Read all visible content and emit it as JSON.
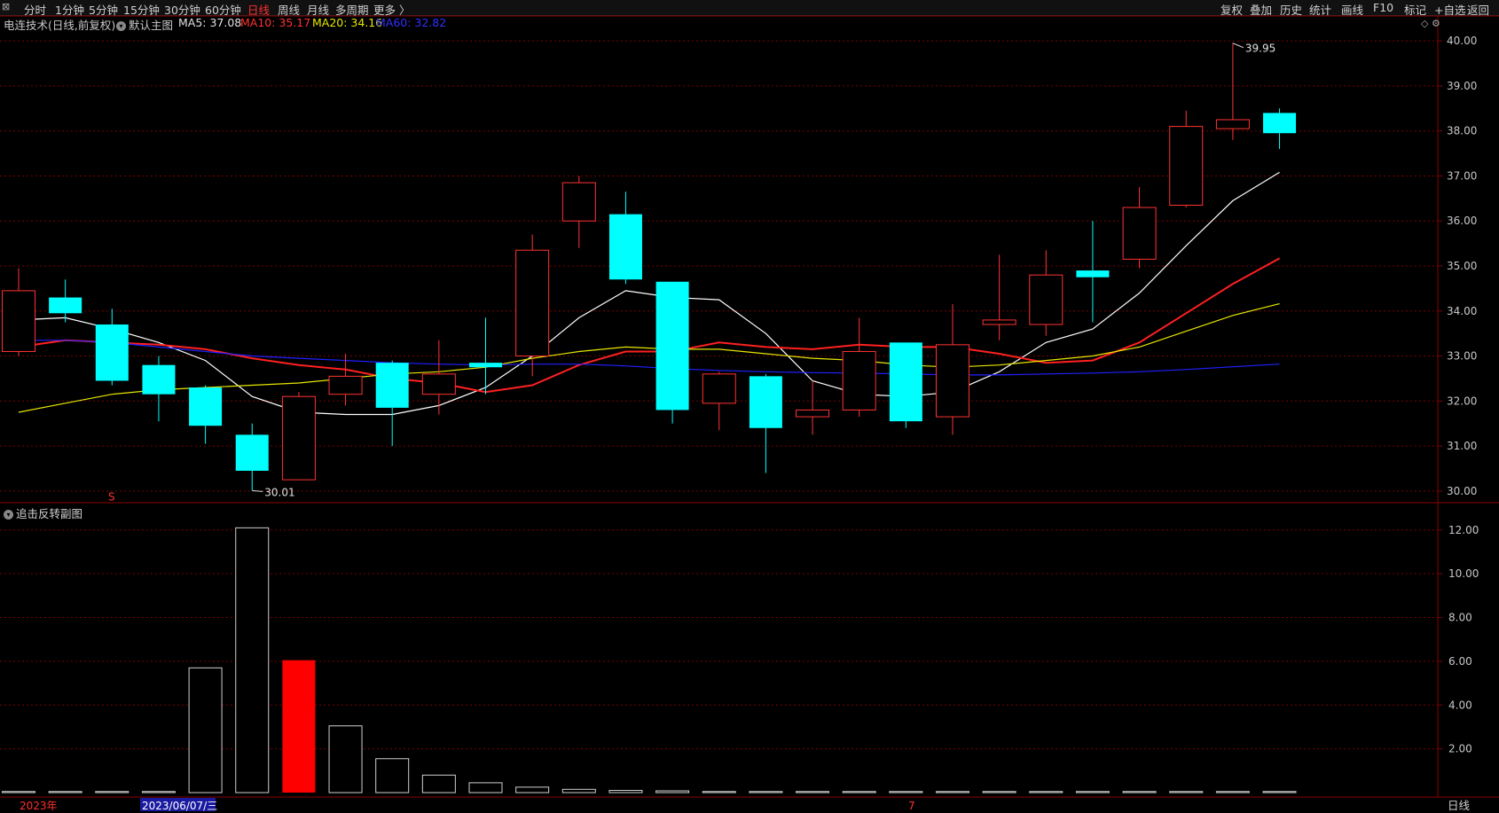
{
  "toolbar": {
    "left_items": [
      "分时",
      "1分钟",
      "5分钟",
      "15分钟",
      "30分钟",
      "60分钟",
      "日线",
      "周线",
      "月线",
      "多周期",
      "更多 〉"
    ],
    "active": "日线",
    "right_items": [
      "复权",
      "叠加",
      "历史",
      "统计",
      "画线",
      "F10",
      "标记",
      "+自选",
      "返回"
    ]
  },
  "legend": {
    "title": "电连技术(日线,前复权)",
    "main_label": "默认主图",
    "ma5": "MA5: 37.08",
    "ma10": "MA10: 35.17",
    "ma20": "MA20: 34.16",
    "ma60": "MA60: 32.82"
  },
  "sub_chart_title": "追击反转副图",
  "bottom_tab": "日线",
  "markers": {
    "high_label": "39.95",
    "low_label": "30.01",
    "signal_s": "S"
  },
  "x_axis": {
    "year_label": "2023年",
    "selected_date": "2023/06/07/三",
    "month_label": "7"
  },
  "colors": {
    "up": "#ff3232",
    "down": "#00ffff",
    "ma5": "#ffffff",
    "ma10": "#ff2020",
    "ma20": "#e6e600",
    "ma60": "#2020ff",
    "grid": "#7a0000"
  },
  "chart_data": [
    {
      "type": "candlestick",
      "title": "电连技术(日线,前复权)",
      "ylim": [
        29.8,
        40.2
      ],
      "y_ticks": [
        "40.00",
        "39.00",
        "38.00",
        "37.00",
        "36.00",
        "35.00",
        "34.00",
        "33.00",
        "32.00",
        "31.00",
        "30.00"
      ],
      "candles": [
        {
          "o": 33.1,
          "h": 34.95,
          "l": 33.0,
          "c": 34.45
        },
        {
          "o": 34.3,
          "h": 34.7,
          "l": 33.75,
          "c": 33.95
        },
        {
          "o": 33.7,
          "h": 34.05,
          "l": 32.35,
          "c": 32.45
        },
        {
          "o": 32.8,
          "h": 33.0,
          "l": 31.55,
          "c": 32.15
        },
        {
          "o": 32.3,
          "h": 32.35,
          "l": 31.05,
          "c": 31.45
        },
        {
          "o": 31.25,
          "h": 31.5,
          "l": 30.01,
          "c": 30.45
        },
        {
          "o": 30.25,
          "h": 32.2,
          "l": 30.25,
          "c": 32.1
        },
        {
          "o": 32.15,
          "h": 33.05,
          "l": 31.9,
          "c": 32.55
        },
        {
          "o": 32.85,
          "h": 32.9,
          "l": 31.0,
          "c": 31.85
        },
        {
          "o": 32.15,
          "h": 33.35,
          "l": 31.7,
          "c": 32.6
        },
        {
          "o": 32.85,
          "h": 33.85,
          "l": 32.15,
          "c": 32.75
        },
        {
          "o": 33.0,
          "h": 35.7,
          "l": 32.55,
          "c": 35.35
        },
        {
          "o": 36.0,
          "h": 37.0,
          "l": 35.4,
          "c": 36.85
        },
        {
          "o": 36.15,
          "h": 36.65,
          "l": 34.6,
          "c": 34.7
        },
        {
          "o": 34.65,
          "h": 34.65,
          "l": 31.5,
          "c": 31.8
        },
        {
          "o": 31.95,
          "h": 32.65,
          "l": 31.35,
          "c": 32.6
        },
        {
          "o": 32.55,
          "h": 32.6,
          "l": 30.4,
          "c": 31.4
        },
        {
          "o": 31.65,
          "h": 32.45,
          "l": 31.25,
          "c": 31.8
        },
        {
          "o": 31.8,
          "h": 33.85,
          "l": 31.65,
          "c": 33.1
        },
        {
          "o": 33.3,
          "h": 33.3,
          "l": 31.4,
          "c": 31.55
        },
        {
          "o": 31.65,
          "h": 34.15,
          "l": 31.25,
          "c": 33.25
        },
        {
          "o": 33.7,
          "h": 35.25,
          "l": 33.35,
          "c": 33.8
        },
        {
          "o": 33.7,
          "h": 35.35,
          "l": 33.45,
          "c": 34.8
        },
        {
          "o": 34.9,
          "h": 36.0,
          "l": 33.75,
          "c": 34.75
        },
        {
          "o": 35.15,
          "h": 36.75,
          "l": 34.95,
          "c": 36.3
        },
        {
          "o": 36.35,
          "h": 38.45,
          "l": 36.3,
          "c": 38.1
        },
        {
          "o": 38.05,
          "h": 39.95,
          "l": 37.8,
          "c": 38.25
        },
        {
          "o": 38.4,
          "h": 38.5,
          "l": 37.6,
          "c": 37.95
        }
      ],
      "series": [
        {
          "name": "MA5",
          "values": [
            33.8,
            33.85,
            33.6,
            33.3,
            32.9,
            32.1,
            31.75,
            31.7,
            31.7,
            31.9,
            32.3,
            33.0,
            33.85,
            34.45,
            34.3,
            34.25,
            33.5,
            32.45,
            32.15,
            32.1,
            32.2,
            32.65,
            33.3,
            33.6,
            34.4,
            35.45,
            36.45,
            37.08
          ]
        },
        {
          "name": "MA10",
          "values": [
            33.2,
            33.35,
            33.3,
            33.25,
            33.15,
            32.95,
            32.8,
            32.7,
            32.5,
            32.4,
            32.2,
            32.35,
            32.8,
            33.1,
            33.1,
            33.3,
            33.2,
            33.15,
            33.25,
            33.2,
            33.2,
            33.05,
            32.85,
            32.9,
            33.3,
            33.95,
            34.6,
            35.17
          ]
        },
        {
          "name": "MA20",
          "values": [
            31.75,
            31.95,
            32.15,
            32.25,
            32.3,
            32.35,
            32.4,
            32.5,
            32.6,
            32.65,
            32.75,
            32.95,
            33.1,
            33.2,
            33.15,
            33.15,
            33.05,
            32.95,
            32.9,
            32.8,
            32.75,
            32.8,
            32.9,
            33.0,
            33.2,
            33.55,
            33.9,
            34.16
          ]
        },
        {
          "name": "MA60",
          "values": [
            33.35,
            33.35,
            33.3,
            33.2,
            33.1,
            33.0,
            32.95,
            32.9,
            32.85,
            32.82,
            32.8,
            32.82,
            32.82,
            32.78,
            32.72,
            32.68,
            32.65,
            32.63,
            32.62,
            32.6,
            32.58,
            32.58,
            32.6,
            32.62,
            32.65,
            32.7,
            32.76,
            32.82
          ]
        }
      ]
    },
    {
      "type": "bar",
      "title": "追击反转副图",
      "ylim": [
        0,
        12.6
      ],
      "y_ticks": [
        "12.00",
        "10.00",
        "8.00",
        "6.00",
        "4.00",
        "2.00"
      ],
      "values": [
        0.05,
        0.05,
        0.05,
        0.05,
        5.7,
        12.1,
        6.05,
        3.05,
        1.55,
        0.8,
        0.45,
        0.25,
        0.15,
        0.1,
        0.08,
        0.05,
        0.05,
        0.05,
        0.05,
        0.05,
        0.05,
        0.05,
        0.05,
        0.05,
        0.05,
        0.05,
        0.05,
        0.05
      ],
      "highlight_index": 6
    }
  ]
}
